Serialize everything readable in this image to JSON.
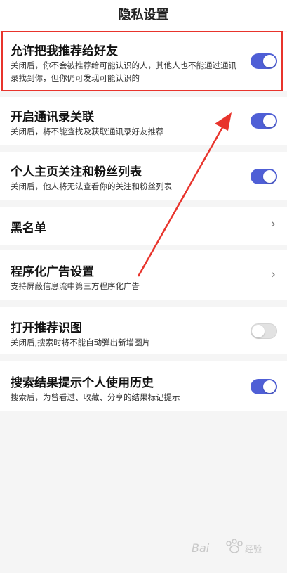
{
  "header": {
    "title": "隐私设置"
  },
  "settings": [
    {
      "title": "允许把我推荐给好友",
      "desc": "关闭后，你不会被推荐给可能认识的人，其他人也不能通过通讯录找到你，但你仍可发现可能认识的",
      "control": "toggle",
      "state": "on"
    },
    {
      "title": "开启通讯录关联",
      "desc": "关闭后，将不能查找及获取通讯录好友推荐",
      "control": "toggle",
      "state": "on"
    },
    {
      "title": "个人主页关注和粉丝列表",
      "desc": "关闭后，他人将无法查看你的关注和粉丝列表",
      "control": "toggle",
      "state": "on"
    },
    {
      "title": "黑名单",
      "desc": "",
      "control": "chevron",
      "chevron": "›"
    },
    {
      "title": "程序化广告设置",
      "desc": "支持屏蔽信息流中第三方程序化广告",
      "control": "chevron",
      "chevron": "›"
    },
    {
      "title": "打开推荐识图",
      "desc": "关闭后,搜索时将不能自动弹出新增图片",
      "control": "toggle",
      "state": "off"
    },
    {
      "title": "搜索结果提示个人使用历史",
      "desc": "搜索后，为曾看过、收藏、分享的结果标记提示",
      "control": "toggle",
      "state": "on"
    }
  ],
  "colors": {
    "toggle_on": "#4f5fd6",
    "highlight": "#e8342c",
    "arrow": "#e8342c"
  },
  "watermark": {
    "text": "Bai du 经验"
  }
}
